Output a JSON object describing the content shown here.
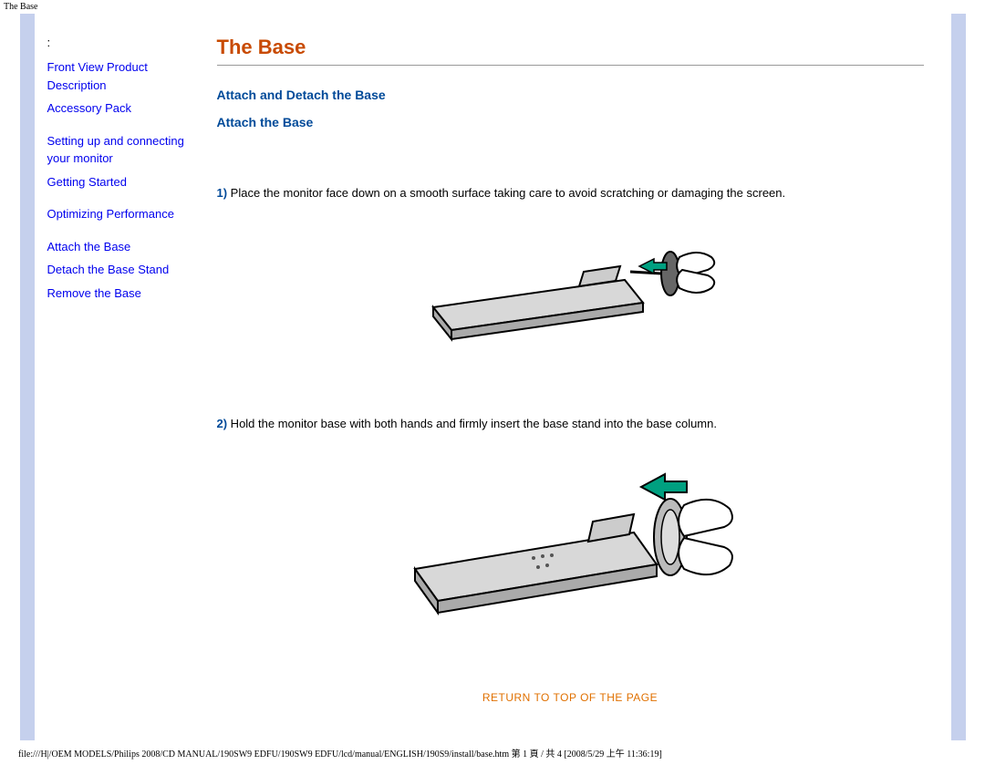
{
  "header": {
    "title": "The Base"
  },
  "sidebar": {
    "group1": {
      "link1": "Front View Product Description",
      "link2": "Accessory Pack"
    },
    "group2": {
      "link1": "Setting up and connecting your monitor",
      "link2": "Getting Started"
    },
    "group3": {
      "link1": "Optimizing Performance"
    },
    "group4": {
      "link1": "Attach the Base",
      "link2": "Detach the Base Stand",
      "link3": "Remove the Base"
    }
  },
  "main": {
    "title": "The Base",
    "section_heading": "Attach and Detach the Base",
    "sub_heading": "Attach the Base",
    "step1_num": "1)",
    "step1_text": " Place the monitor face down on a smooth surface taking care to avoid scratching or damaging the screen.",
    "step2_num": "2)",
    "step2_text": " Hold the monitor base with both hands and firmly insert the base stand into the base column.",
    "return_link": "RETURN TO TOP OF THE PAGE"
  },
  "footer": {
    "path": "file:///H|/OEM MODELS/Philips 2008/CD MANUAL/190SW9 EDFU/190SW9 EDFU/lcd/manual/ENGLISH/190S9/install/base.htm 第 1 頁 / 共 4  [2008/5/29 上午 11:36:19]"
  }
}
